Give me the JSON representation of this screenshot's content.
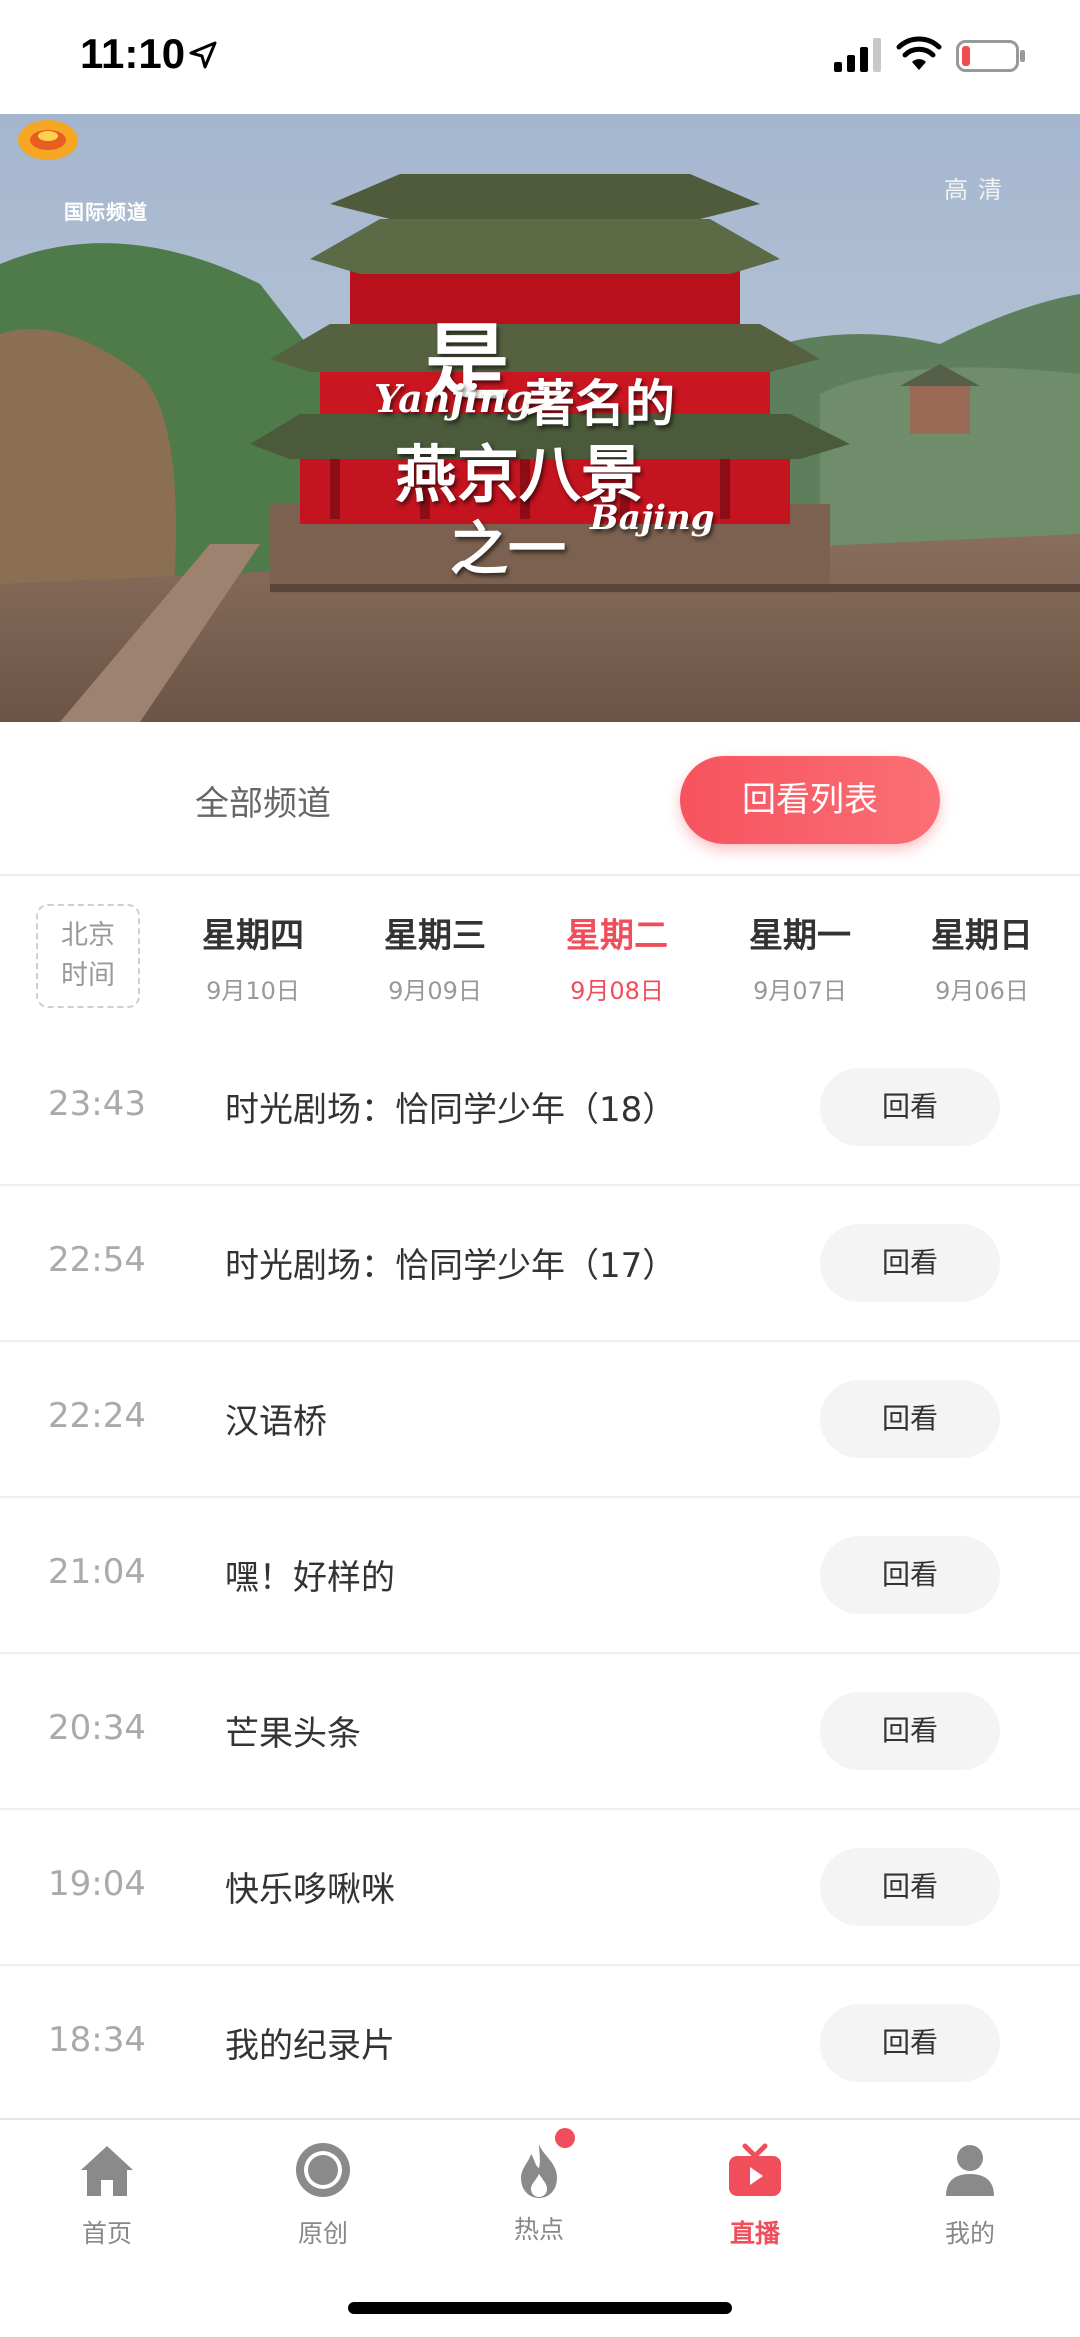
{
  "status_bar": {
    "time": "11:10",
    "icons": [
      "location-arrow-icon",
      "signal-icon",
      "wifi-icon",
      "battery-low-icon"
    ],
    "battery_color": "#f04e4e"
  },
  "video": {
    "logo_text": "国际频道",
    "quality": "高清",
    "overlay_line1": "是",
    "overlay_latin1": "Yanjing",
    "overlay_line2": "著名的",
    "overlay_line3": "燕京八景",
    "overlay_line4": "之一",
    "overlay_latin2": "Bajing"
  },
  "tabs": {
    "all_channels": "全部频道",
    "replay_list": "回看列表"
  },
  "accent_color": "#f04e5a",
  "timezone_label": [
    "北京",
    "时间"
  ],
  "days": [
    {
      "name": "星期四",
      "date": "9月10日",
      "active": false
    },
    {
      "name": "星期三",
      "date": "9月09日",
      "active": false
    },
    {
      "name": "星期二",
      "date": "9月08日",
      "active": true
    },
    {
      "name": "星期一",
      "date": "9月07日",
      "active": false
    },
    {
      "name": "星期日",
      "date": "9月06日",
      "active": false
    }
  ],
  "programs": [
    {
      "time": "23:43",
      "title": "时光剧场：恰同学少年（18）",
      "action": "回看"
    },
    {
      "time": "22:54",
      "title": "时光剧场：恰同学少年（17）",
      "action": "回看"
    },
    {
      "time": "22:24",
      "title": "汉语桥",
      "action": "回看"
    },
    {
      "time": "21:04",
      "title": "嘿！好样的",
      "action": "回看"
    },
    {
      "time": "20:34",
      "title": "芒果头条",
      "action": "回看"
    },
    {
      "time": "19:04",
      "title": "快乐哆啾咪",
      "action": "回看"
    },
    {
      "time": "18:34",
      "title": "我的纪录片",
      "action": "回看"
    }
  ],
  "nav": [
    {
      "label": "首页",
      "icon": "home-icon",
      "active": false
    },
    {
      "label": "原创",
      "icon": "original-disc-icon",
      "active": false
    },
    {
      "label": "热点",
      "icon": "flame-icon",
      "active": false,
      "badge": true
    },
    {
      "label": "直播",
      "icon": "live-tv-icon",
      "active": true
    },
    {
      "label": "我的",
      "icon": "profile-icon",
      "active": false
    }
  ]
}
